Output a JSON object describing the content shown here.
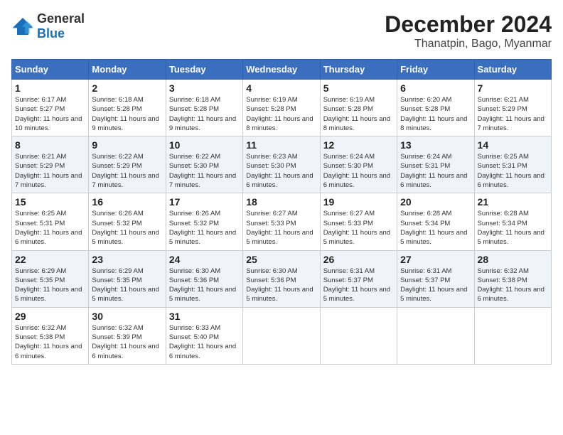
{
  "logo": {
    "general": "General",
    "blue": "Blue"
  },
  "header": {
    "month": "December 2024",
    "location": "Thanatpin, Bago, Myanmar"
  },
  "weekdays": [
    "Sunday",
    "Monday",
    "Tuesday",
    "Wednesday",
    "Thursday",
    "Friday",
    "Saturday"
  ],
  "weeks": [
    [
      {
        "day": "1",
        "sunrise": "6:17 AM",
        "sunset": "5:27 PM",
        "daylight": "11 hours and 10 minutes."
      },
      {
        "day": "2",
        "sunrise": "6:18 AM",
        "sunset": "5:28 PM",
        "daylight": "11 hours and 9 minutes."
      },
      {
        "day": "3",
        "sunrise": "6:18 AM",
        "sunset": "5:28 PM",
        "daylight": "11 hours and 9 minutes."
      },
      {
        "day": "4",
        "sunrise": "6:19 AM",
        "sunset": "5:28 PM",
        "daylight": "11 hours and 8 minutes."
      },
      {
        "day": "5",
        "sunrise": "6:19 AM",
        "sunset": "5:28 PM",
        "daylight": "11 hours and 8 minutes."
      },
      {
        "day": "6",
        "sunrise": "6:20 AM",
        "sunset": "5:28 PM",
        "daylight": "11 hours and 8 minutes."
      },
      {
        "day": "7",
        "sunrise": "6:21 AM",
        "sunset": "5:29 PM",
        "daylight": "11 hours and 7 minutes."
      }
    ],
    [
      {
        "day": "8",
        "sunrise": "6:21 AM",
        "sunset": "5:29 PM",
        "daylight": "11 hours and 7 minutes."
      },
      {
        "day": "9",
        "sunrise": "6:22 AM",
        "sunset": "5:29 PM",
        "daylight": "11 hours and 7 minutes."
      },
      {
        "day": "10",
        "sunrise": "6:22 AM",
        "sunset": "5:30 PM",
        "daylight": "11 hours and 7 minutes."
      },
      {
        "day": "11",
        "sunrise": "6:23 AM",
        "sunset": "5:30 PM",
        "daylight": "11 hours and 6 minutes."
      },
      {
        "day": "12",
        "sunrise": "6:24 AM",
        "sunset": "5:30 PM",
        "daylight": "11 hours and 6 minutes."
      },
      {
        "day": "13",
        "sunrise": "6:24 AM",
        "sunset": "5:31 PM",
        "daylight": "11 hours and 6 minutes."
      },
      {
        "day": "14",
        "sunrise": "6:25 AM",
        "sunset": "5:31 PM",
        "daylight": "11 hours and 6 minutes."
      }
    ],
    [
      {
        "day": "15",
        "sunrise": "6:25 AM",
        "sunset": "5:31 PM",
        "daylight": "11 hours and 6 minutes."
      },
      {
        "day": "16",
        "sunrise": "6:26 AM",
        "sunset": "5:32 PM",
        "daylight": "11 hours and 5 minutes."
      },
      {
        "day": "17",
        "sunrise": "6:26 AM",
        "sunset": "5:32 PM",
        "daylight": "11 hours and 5 minutes."
      },
      {
        "day": "18",
        "sunrise": "6:27 AM",
        "sunset": "5:33 PM",
        "daylight": "11 hours and 5 minutes."
      },
      {
        "day": "19",
        "sunrise": "6:27 AM",
        "sunset": "5:33 PM",
        "daylight": "11 hours and 5 minutes."
      },
      {
        "day": "20",
        "sunrise": "6:28 AM",
        "sunset": "5:34 PM",
        "daylight": "11 hours and 5 minutes."
      },
      {
        "day": "21",
        "sunrise": "6:28 AM",
        "sunset": "5:34 PM",
        "daylight": "11 hours and 5 minutes."
      }
    ],
    [
      {
        "day": "22",
        "sunrise": "6:29 AM",
        "sunset": "5:35 PM",
        "daylight": "11 hours and 5 minutes."
      },
      {
        "day": "23",
        "sunrise": "6:29 AM",
        "sunset": "5:35 PM",
        "daylight": "11 hours and 5 minutes."
      },
      {
        "day": "24",
        "sunrise": "6:30 AM",
        "sunset": "5:36 PM",
        "daylight": "11 hours and 5 minutes."
      },
      {
        "day": "25",
        "sunrise": "6:30 AM",
        "sunset": "5:36 PM",
        "daylight": "11 hours and 5 minutes."
      },
      {
        "day": "26",
        "sunrise": "6:31 AM",
        "sunset": "5:37 PM",
        "daylight": "11 hours and 5 minutes."
      },
      {
        "day": "27",
        "sunrise": "6:31 AM",
        "sunset": "5:37 PM",
        "daylight": "11 hours and 5 minutes."
      },
      {
        "day": "28",
        "sunrise": "6:32 AM",
        "sunset": "5:38 PM",
        "daylight": "11 hours and 6 minutes."
      }
    ],
    [
      {
        "day": "29",
        "sunrise": "6:32 AM",
        "sunset": "5:38 PM",
        "daylight": "11 hours and 6 minutes."
      },
      {
        "day": "30",
        "sunrise": "6:32 AM",
        "sunset": "5:39 PM",
        "daylight": "11 hours and 6 minutes."
      },
      {
        "day": "31",
        "sunrise": "6:33 AM",
        "sunset": "5:40 PM",
        "daylight": "11 hours and 6 minutes."
      },
      null,
      null,
      null,
      null
    ]
  ],
  "labels": {
    "sunrise": "Sunrise: ",
    "sunset": "Sunset: ",
    "daylight": "Daylight: "
  }
}
